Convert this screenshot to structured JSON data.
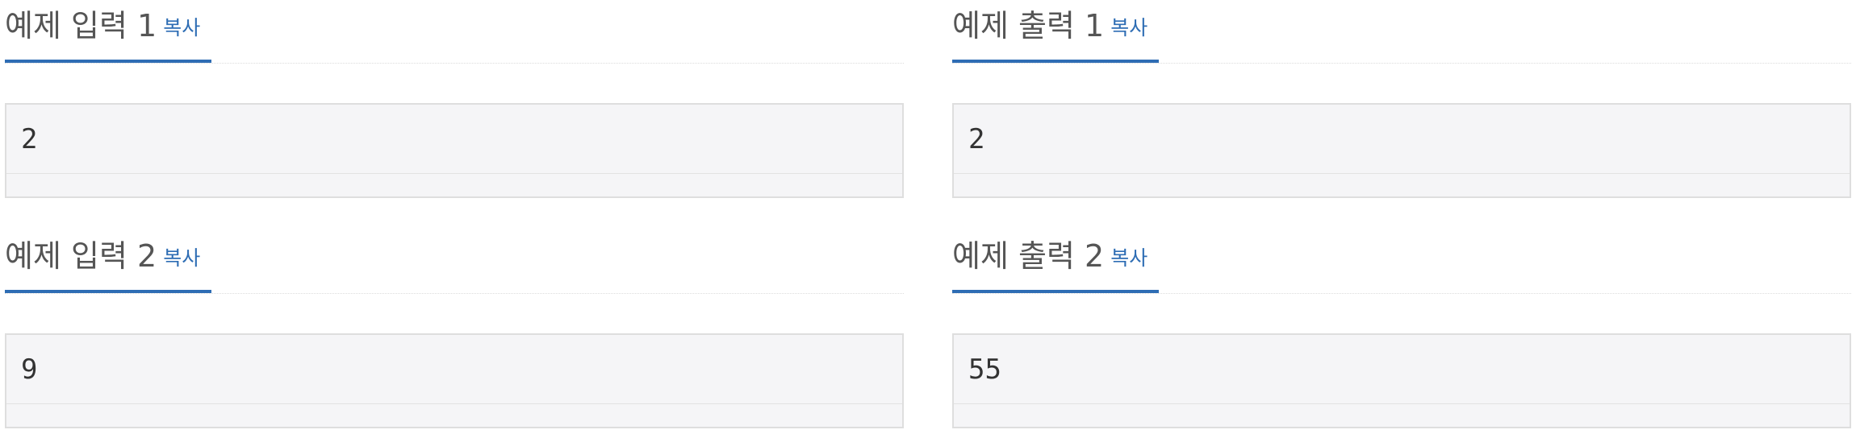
{
  "samples": [
    {
      "title": "예제 입력 1",
      "copy_label": "복사",
      "value": "2"
    },
    {
      "title": "예제 출력 1",
      "copy_label": "복사",
      "value": "2"
    },
    {
      "title": "예제 입력 2",
      "copy_label": "복사",
      "value": "9"
    },
    {
      "title": "예제 출력 2",
      "copy_label": "복사",
      "value": "55"
    }
  ],
  "colors": {
    "accent": "#2e6db4",
    "heading_text": "#555555",
    "box_background": "#f5f5f7",
    "box_border": "#dedede"
  }
}
